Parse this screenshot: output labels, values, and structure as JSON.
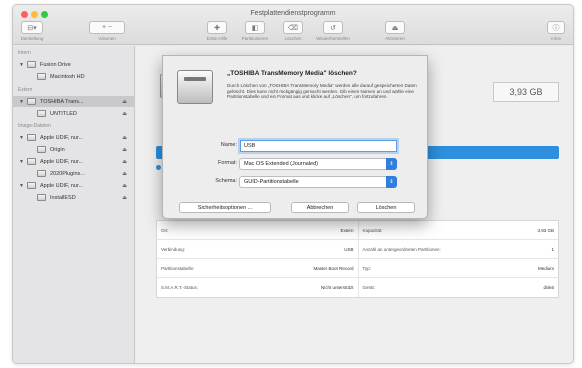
{
  "window": {
    "title": "Festplattendienstprogramm"
  },
  "toolbar": {
    "items": [
      {
        "glyph": "⊟▾",
        "label": "Darstellung"
      },
      {
        "glyph": "+  −",
        "label": "Volumen"
      },
      {
        "glyph": "✚",
        "label": "Erste Hilfe"
      },
      {
        "glyph": "◧",
        "label": "Partitionieren"
      },
      {
        "glyph": "⌫",
        "label": "Löschen"
      },
      {
        "glyph": "↺",
        "label": "Wiederherstellen"
      },
      {
        "glyph": "⏏",
        "label": "Aktivieren"
      },
      {
        "glyph": "ⓘ",
        "label": "Infos"
      }
    ]
  },
  "sidebar": {
    "sections": {
      "intern": "Intern",
      "extern": "Extern",
      "images": "Image-Dateien"
    },
    "items": [
      {
        "label": "Fusion Drive"
      },
      {
        "label": "Macintosh HD"
      },
      {
        "label": "TOSHIBA Trans..."
      },
      {
        "label": "UNTITLED"
      },
      {
        "label": "Apple UDIF, nur..."
      },
      {
        "label": "Origin"
      },
      {
        "label": "Apple UDIF, nur..."
      },
      {
        "label": "2020Plugins..."
      },
      {
        "label": "Apple UDIF, nur..."
      },
      {
        "label": "InstallESD"
      }
    ],
    "eject_glyph": "⏏"
  },
  "main": {
    "capacity": "3,93 GB",
    "info": {
      "left": [
        {
          "label": "Ort:",
          "value": "Extern"
        },
        {
          "label": "Verbindung:",
          "value": "USB"
        },
        {
          "label": "Partitionstabelle:",
          "value": "Master Boot Record"
        },
        {
          "label": "S.M.A.R.T.-Status:",
          "value": "Nicht unterstützt"
        }
      ],
      "right": [
        {
          "label": "Kapazität:",
          "value": "3,93 GB"
        },
        {
          "label": "Anzahl an untergeordneten Partitionen:",
          "value": "1"
        },
        {
          "label": "Typ:",
          "value": "Medium"
        },
        {
          "label": "Gerät:",
          "value": "disk6"
        }
      ]
    }
  },
  "dialog": {
    "title": "„TOSHIBA TransMemory Media\" löschen?",
    "description": "Durch Löschen von „TOSHIBA TransMemory Media\" werden alle darauf gespeicherten Daten gelöscht. Dies kann nicht rückgängig gemacht werden. Gib einen Namen an und wähle eine Partitionstabelle und ein Format aus und klicke auf „Löschen\", um fortzufahren.",
    "name_label": "Name:",
    "name_value": "USB",
    "format_label": "Format:",
    "format_value": "Mac OS Extended (Journaled)",
    "schema_label": "Schema:",
    "schema_value": "GUID-Partitionstabelle",
    "buttons": {
      "security": "Sicherheitsoptionen ...",
      "cancel": "Abbrechen",
      "erase": "Löschen"
    }
  },
  "colors": {
    "accent": "#2f7ee0",
    "usage_bar": "#2d8fdd"
  }
}
